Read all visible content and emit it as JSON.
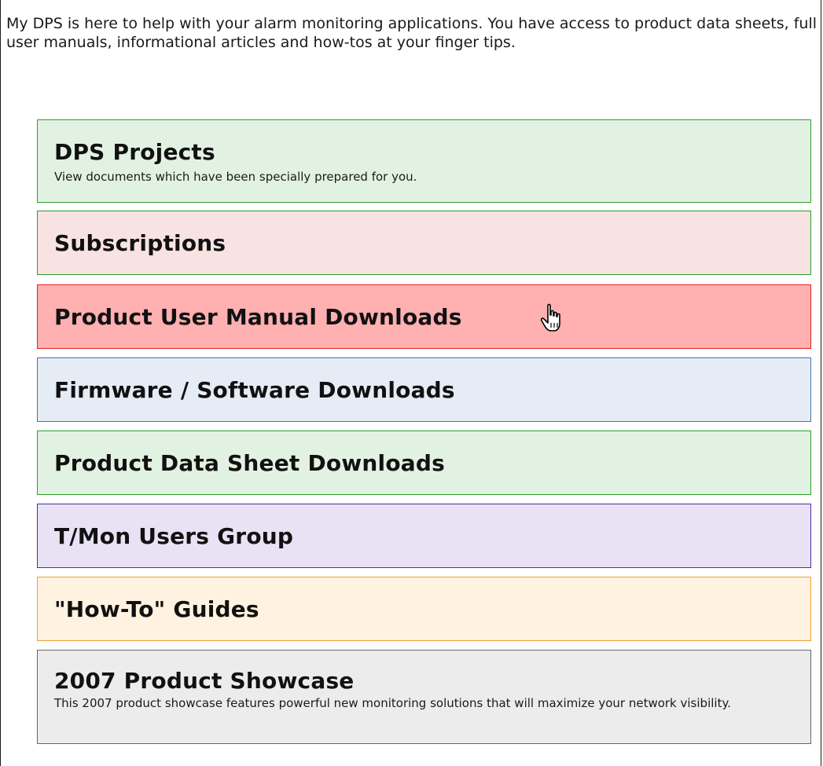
{
  "intro_text": "My DPS is here to help with your alarm monitoring applications. You have access to product data sheets, full user manuals, informational articles and how-tos at your finger tips.",
  "menu": {
    "items": [
      {
        "title": "DPS Projects",
        "description": "View documents which have been specially prepared for you.",
        "background": "#e2f2e2",
        "border": "#2ca02c"
      },
      {
        "title": "Subscriptions",
        "background": "#f8e2e2",
        "border": "#2ca02c"
      },
      {
        "title": "Product User Manual Downloads",
        "background": "#ffb0b0",
        "border": "#e02020",
        "state": "hover"
      },
      {
        "title": "Firmware / Software Downloads",
        "background": "#e6ecf6",
        "border": "#4d6fa0"
      },
      {
        "title": "Product Data Sheet Downloads",
        "background": "#e2f2e2",
        "border": "#2ca02c"
      },
      {
        "title": "T/Mon Users Group",
        "background": "#e8e2f4",
        "border": "#4b2ca0"
      },
      {
        "title": "\"How-To\" Guides",
        "background": "#fff2e0",
        "border": "#f0a030"
      },
      {
        "title": "2007 Product Showcase",
        "description": "This 2007 product showcase features powerful new monitoring solutions that will maximize your network visibility.",
        "background": "#ececec",
        "border": "#666666"
      }
    ]
  },
  "cursor": {
    "icon": "hand-pointer-icon"
  }
}
